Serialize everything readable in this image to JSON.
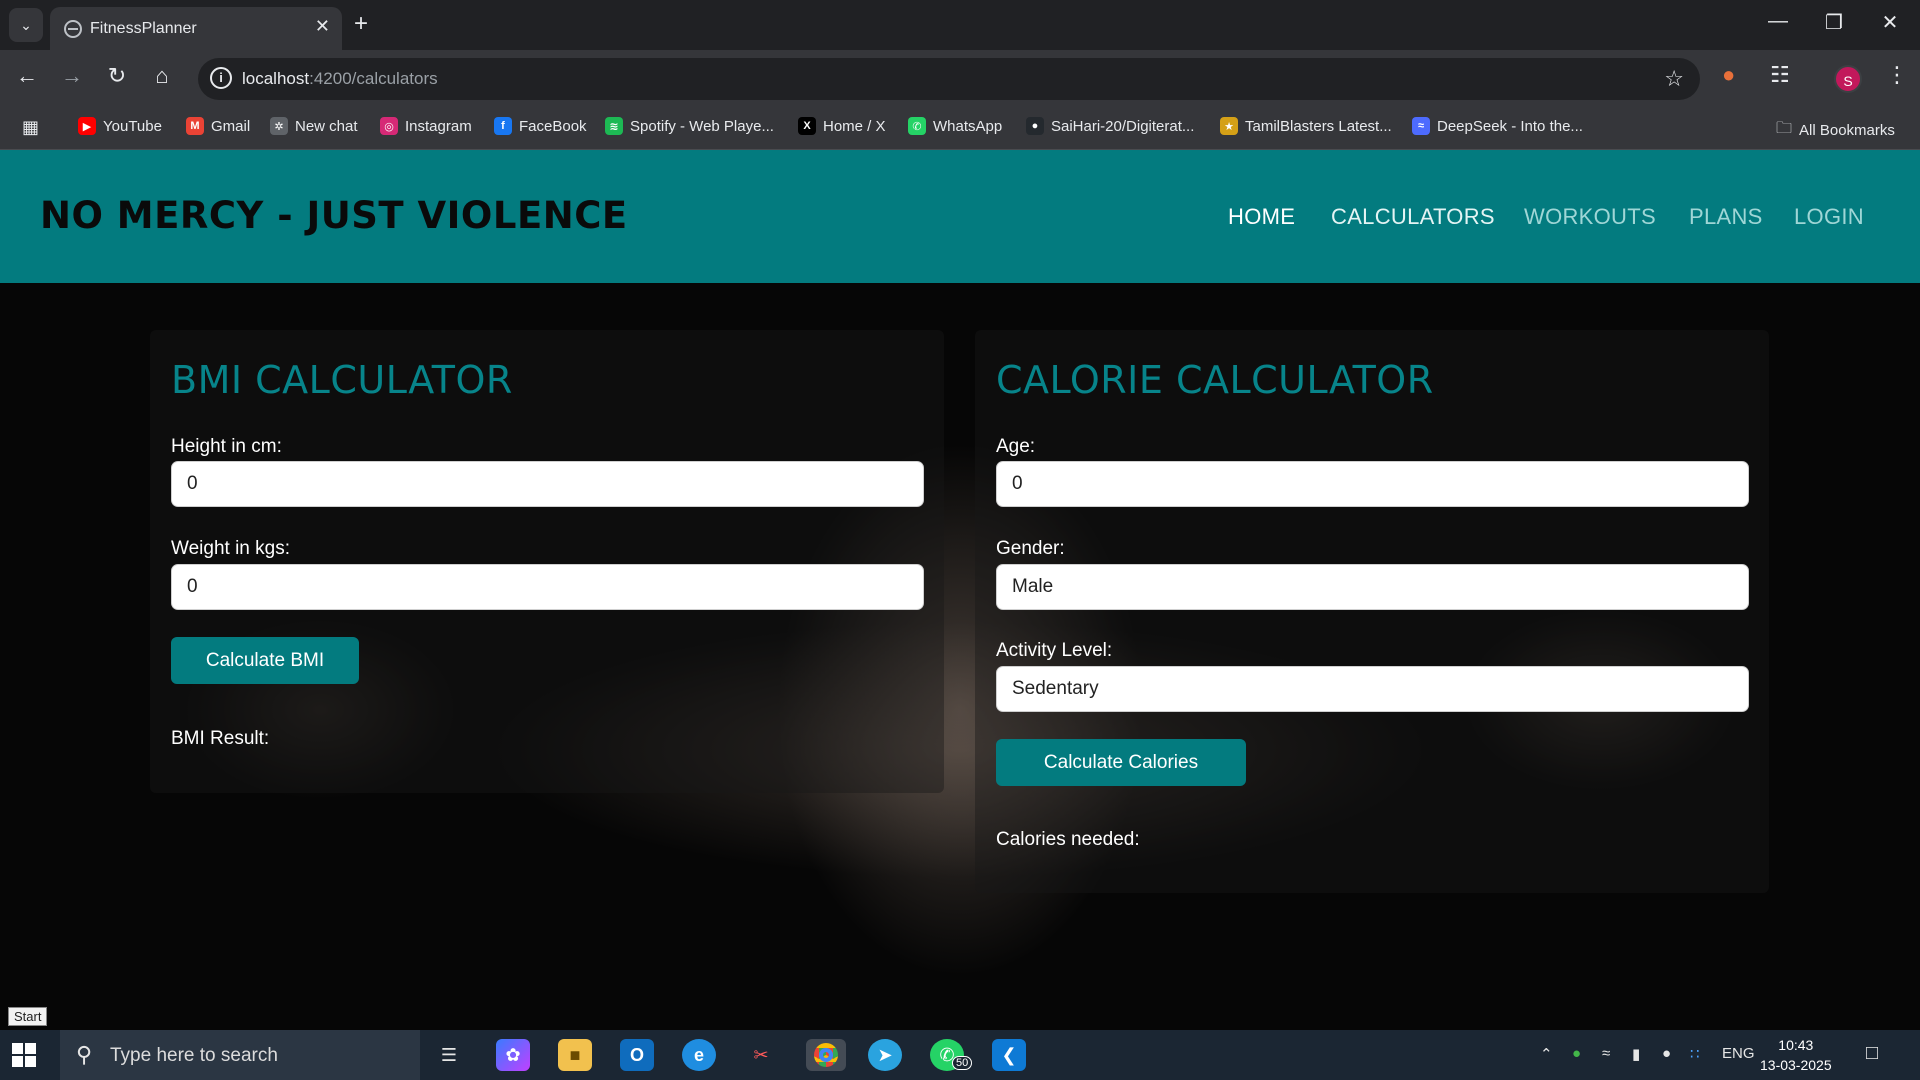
{
  "browser": {
    "tab_title": "FitnessPlanner",
    "url_host": "localhost",
    "url_path": ":4200/calculators",
    "profile_initial": "S",
    "bookmarks": [
      {
        "label": "YouTube",
        "icon": "youtube-icon",
        "color": "#ff0000"
      },
      {
        "label": "Gmail",
        "icon": "gmail-icon",
        "color": "#ea4335"
      },
      {
        "label": "New chat",
        "icon": "chatgpt-icon",
        "color": "#5f6368"
      },
      {
        "label": "Instagram",
        "icon": "instagram-icon",
        "color": "#d62976"
      },
      {
        "label": "FaceBook",
        "icon": "facebook-icon",
        "color": "#1877f2"
      },
      {
        "label": "Spotify - Web Playe...",
        "icon": "spotify-icon",
        "color": "#1db954"
      },
      {
        "label": "Home / X",
        "icon": "x-icon",
        "color": "#000000"
      },
      {
        "label": "WhatsApp",
        "icon": "whatsapp-icon",
        "color": "#25d366"
      },
      {
        "label": "SaiHari-20/Digiterat...",
        "icon": "github-icon",
        "color": "#24292e"
      },
      {
        "label": "TamilBlasters Latest...",
        "icon": "tamilblasters-icon",
        "color": "#d4a017"
      },
      {
        "label": "DeepSeek - Into the...",
        "icon": "deepseek-icon",
        "color": "#4d6bfe"
      }
    ],
    "all_bookmarks": "All Bookmarks"
  },
  "site": {
    "brand": "NO MERCY - JUST VIOLENCE",
    "nav": [
      "HOME",
      "CALCULATORS",
      "WORKOUTS",
      "PLANS",
      "LOGIN"
    ],
    "accent": "#037b7f"
  },
  "bmi": {
    "heading": "BMI CALCULATOR",
    "height_label": "Height in cm:",
    "height_value": "0",
    "weight_label": "Weight in kgs:",
    "weight_value": "0",
    "button": "Calculate BMI",
    "result_label": "BMI Result:"
  },
  "calorie": {
    "heading": "CALORIE CALCULATOR",
    "age_label": "Age:",
    "age_value": "0",
    "gender_label": "Gender:",
    "gender_value": "Male",
    "activity_label": "Activity Level:",
    "activity_value": "Sedentary",
    "button": "Calculate Calories",
    "result_label": "Calories needed:"
  },
  "taskbar": {
    "start_tooltip": "Start",
    "search_placeholder": "Type here to search",
    "whatsapp_badge": "50",
    "language": "ENG",
    "time": "10:43",
    "date": "13-03-2025"
  }
}
